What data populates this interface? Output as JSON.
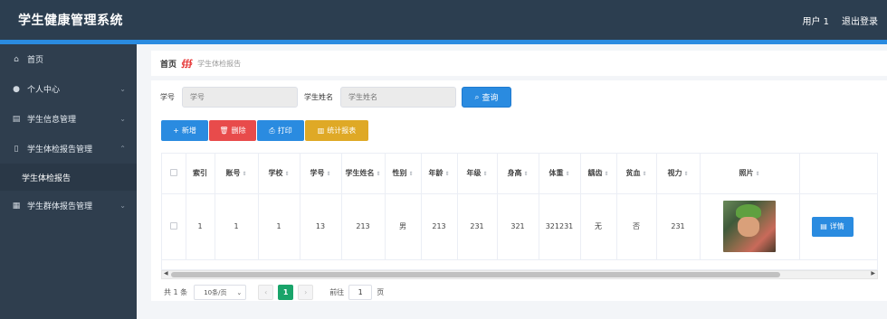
{
  "header": {
    "title": "学生健康管理系统",
    "user": "用户 1",
    "logout": "退出登录"
  },
  "sidebar": {
    "items": [
      {
        "label": "首页",
        "icon": "home-icon",
        "glyph": "⌂"
      },
      {
        "label": "个人中心",
        "icon": "user-icon",
        "glyph": "👤"
      },
      {
        "label": "学生信息管理",
        "icon": "id-card-icon",
        "glyph": "▤"
      },
      {
        "label": "学生体检报告管理",
        "icon": "clipboard-icon",
        "glyph": "▯"
      },
      {
        "label": "学生群体报告管理",
        "icon": "document-icon",
        "glyph": "▦"
      }
    ],
    "sub_active": "学生体检报告"
  },
  "breadcrumb": {
    "home": "首页",
    "current": "学生体检报告"
  },
  "search": {
    "label_id": "学号",
    "placeholder_id": "学号",
    "label_name": "学生姓名",
    "placeholder_name": "学生姓名",
    "query": "查询"
  },
  "actions": {
    "add": "新增",
    "delete": "删除",
    "print": "打印",
    "stats": "统计报表"
  },
  "table": {
    "headers": [
      "索引",
      "账号",
      "学校",
      "学号",
      "学生姓名",
      "性别",
      "年龄",
      "年级",
      "身高",
      "体重",
      "龋齿",
      "贫血",
      "视力",
      "照片"
    ],
    "rows": [
      {
        "index": "1",
        "account": "1",
        "school": "1",
        "student_id": "13",
        "name": "213",
        "gender": "男",
        "age": "213",
        "grade": "231",
        "height": "321",
        "weight": "321231",
        "caries": "无",
        "anemia": "否",
        "vision": "231",
        "detail": "详情"
      }
    ]
  },
  "pagination": {
    "total": "共 1 条",
    "page_size": "10条/页",
    "current_page": "1",
    "goto_label": "前往",
    "goto_value": "1",
    "page_suffix": "页"
  },
  "colors": {
    "header_bg": "#2c3e50",
    "accent": "#2a8be0",
    "danger": "#e84b4b",
    "warning": "#dfa926",
    "page_active": "#19a46a"
  }
}
